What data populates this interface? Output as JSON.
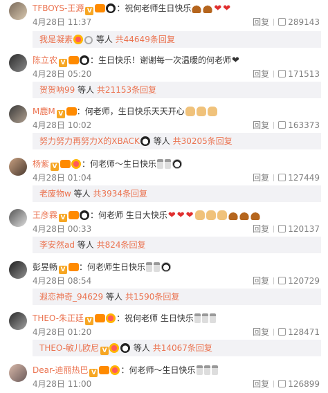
{
  "comments": [
    {
      "user": "TFBOYS-王源",
      "text": "：祝何老师生日快乐",
      "time": "4月28日 11:37",
      "reply_label": "回复",
      "likes": "289143",
      "sub": {
        "name": "我是凝素",
        "mid": " 等人 ",
        "count": "共44649条回复"
      }
    },
    {
      "user": "陈立农",
      "text": "：生日快乐！谢谢每一次温暖的何老师",
      "time": "4月28日 05:20",
      "reply_label": "回复",
      "likes": "171513",
      "sub": {
        "name": "贺贺呐99",
        "mid": " 等人 ",
        "count": "共21153条回复"
      }
    },
    {
      "user": "M鹿M",
      "text": "：何老师，生日快乐天天开心",
      "time": "4月28日 10:02",
      "reply_label": "回复",
      "likes": "163373",
      "sub": {
        "name": "努力努力再努力X的XBACK",
        "mid": " 等人 ",
        "count": "共30205条回复"
      }
    },
    {
      "user": "杨紫",
      "text": "：何老师～生日快乐",
      "time": "4月28日 01:04",
      "reply_label": "回复",
      "likes": "127449",
      "sub": {
        "name": "老废物w",
        "mid": " 等人 ",
        "count": "共3934条回复"
      }
    },
    {
      "user": "王彦霖",
      "text": "：何老师 生日大快乐",
      "time": "4月28日 00:33",
      "reply_label": "回复",
      "likes": "120137",
      "sub": {
        "name": "李安然ad",
        "mid": " 等人 ",
        "count": "共824条回复"
      }
    },
    {
      "user": "彭昱畅",
      "text": "：何老师生日快乐",
      "time": "4月28日 08:54",
      "reply_label": "回复",
      "likes": "120729",
      "sub": {
        "name": "遐恋神奇_94629",
        "mid": " 等人 ",
        "count": "共1590条回复"
      }
    },
    {
      "user": "THEO-朱正廷",
      "text": "：祝何老师 生日快乐",
      "time": "4月28日 01:20",
      "reply_label": "回复",
      "likes": "128471",
      "sub": {
        "name": "THEO-敏儿欧尼",
        "mid": " 等人 ",
        "count": "共14067条回复"
      }
    },
    {
      "user": "Dear-迪丽热巴",
      "text": "：何老师～生日快乐",
      "time": "4月28日 11:00",
      "reply_label": "回复",
      "likes": "126899"
    }
  ],
  "badge_v_label": "V",
  "colors": {
    "username": "#eb7350",
    "subbox_bg": "#f2f2f5",
    "meta": "#808080"
  }
}
